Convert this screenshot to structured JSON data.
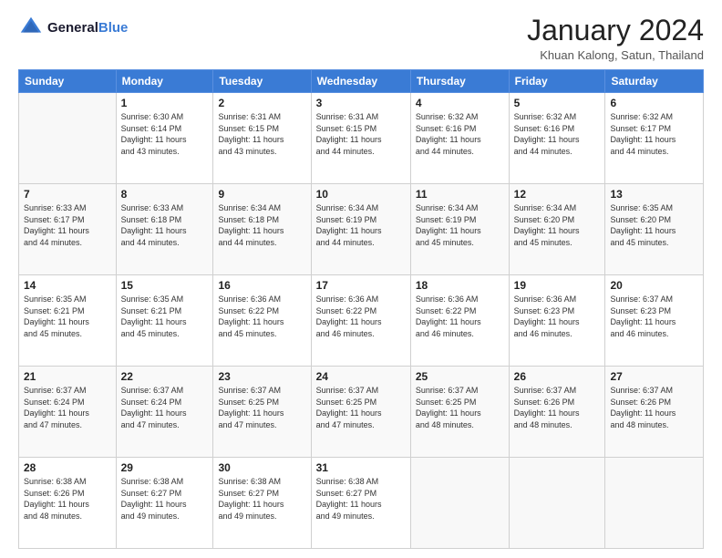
{
  "logo": {
    "line1": "General",
    "line2": "Blue"
  },
  "header": {
    "month_title": "January 2024",
    "location": "Khuan Kalong, Satun, Thailand"
  },
  "weekdays": [
    "Sunday",
    "Monday",
    "Tuesday",
    "Wednesday",
    "Thursday",
    "Friday",
    "Saturday"
  ],
  "weeks": [
    [
      {
        "day": "",
        "info": ""
      },
      {
        "day": "1",
        "info": "Sunrise: 6:30 AM\nSunset: 6:14 PM\nDaylight: 11 hours\nand 43 minutes."
      },
      {
        "day": "2",
        "info": "Sunrise: 6:31 AM\nSunset: 6:15 PM\nDaylight: 11 hours\nand 43 minutes."
      },
      {
        "day": "3",
        "info": "Sunrise: 6:31 AM\nSunset: 6:15 PM\nDaylight: 11 hours\nand 44 minutes."
      },
      {
        "day": "4",
        "info": "Sunrise: 6:32 AM\nSunset: 6:16 PM\nDaylight: 11 hours\nand 44 minutes."
      },
      {
        "day": "5",
        "info": "Sunrise: 6:32 AM\nSunset: 6:16 PM\nDaylight: 11 hours\nand 44 minutes."
      },
      {
        "day": "6",
        "info": "Sunrise: 6:32 AM\nSunset: 6:17 PM\nDaylight: 11 hours\nand 44 minutes."
      }
    ],
    [
      {
        "day": "7",
        "info": "Sunrise: 6:33 AM\nSunset: 6:17 PM\nDaylight: 11 hours\nand 44 minutes."
      },
      {
        "day": "8",
        "info": "Sunrise: 6:33 AM\nSunset: 6:18 PM\nDaylight: 11 hours\nand 44 minutes."
      },
      {
        "day": "9",
        "info": "Sunrise: 6:34 AM\nSunset: 6:18 PM\nDaylight: 11 hours\nand 44 minutes."
      },
      {
        "day": "10",
        "info": "Sunrise: 6:34 AM\nSunset: 6:19 PM\nDaylight: 11 hours\nand 44 minutes."
      },
      {
        "day": "11",
        "info": "Sunrise: 6:34 AM\nSunset: 6:19 PM\nDaylight: 11 hours\nand 45 minutes."
      },
      {
        "day": "12",
        "info": "Sunrise: 6:34 AM\nSunset: 6:20 PM\nDaylight: 11 hours\nand 45 minutes."
      },
      {
        "day": "13",
        "info": "Sunrise: 6:35 AM\nSunset: 6:20 PM\nDaylight: 11 hours\nand 45 minutes."
      }
    ],
    [
      {
        "day": "14",
        "info": "Sunrise: 6:35 AM\nSunset: 6:21 PM\nDaylight: 11 hours\nand 45 minutes."
      },
      {
        "day": "15",
        "info": "Sunrise: 6:35 AM\nSunset: 6:21 PM\nDaylight: 11 hours\nand 45 minutes."
      },
      {
        "day": "16",
        "info": "Sunrise: 6:36 AM\nSunset: 6:22 PM\nDaylight: 11 hours\nand 45 minutes."
      },
      {
        "day": "17",
        "info": "Sunrise: 6:36 AM\nSunset: 6:22 PM\nDaylight: 11 hours\nand 46 minutes."
      },
      {
        "day": "18",
        "info": "Sunrise: 6:36 AM\nSunset: 6:22 PM\nDaylight: 11 hours\nand 46 minutes."
      },
      {
        "day": "19",
        "info": "Sunrise: 6:36 AM\nSunset: 6:23 PM\nDaylight: 11 hours\nand 46 minutes."
      },
      {
        "day": "20",
        "info": "Sunrise: 6:37 AM\nSunset: 6:23 PM\nDaylight: 11 hours\nand 46 minutes."
      }
    ],
    [
      {
        "day": "21",
        "info": "Sunrise: 6:37 AM\nSunset: 6:24 PM\nDaylight: 11 hours\nand 47 minutes."
      },
      {
        "day": "22",
        "info": "Sunrise: 6:37 AM\nSunset: 6:24 PM\nDaylight: 11 hours\nand 47 minutes."
      },
      {
        "day": "23",
        "info": "Sunrise: 6:37 AM\nSunset: 6:25 PM\nDaylight: 11 hours\nand 47 minutes."
      },
      {
        "day": "24",
        "info": "Sunrise: 6:37 AM\nSunset: 6:25 PM\nDaylight: 11 hours\nand 47 minutes."
      },
      {
        "day": "25",
        "info": "Sunrise: 6:37 AM\nSunset: 6:25 PM\nDaylight: 11 hours\nand 48 minutes."
      },
      {
        "day": "26",
        "info": "Sunrise: 6:37 AM\nSunset: 6:26 PM\nDaylight: 11 hours\nand 48 minutes."
      },
      {
        "day": "27",
        "info": "Sunrise: 6:37 AM\nSunset: 6:26 PM\nDaylight: 11 hours\nand 48 minutes."
      }
    ],
    [
      {
        "day": "28",
        "info": "Sunrise: 6:38 AM\nSunset: 6:26 PM\nDaylight: 11 hours\nand 48 minutes."
      },
      {
        "day": "29",
        "info": "Sunrise: 6:38 AM\nSunset: 6:27 PM\nDaylight: 11 hours\nand 49 minutes."
      },
      {
        "day": "30",
        "info": "Sunrise: 6:38 AM\nSunset: 6:27 PM\nDaylight: 11 hours\nand 49 minutes."
      },
      {
        "day": "31",
        "info": "Sunrise: 6:38 AM\nSunset: 6:27 PM\nDaylight: 11 hours\nand 49 minutes."
      },
      {
        "day": "",
        "info": ""
      },
      {
        "day": "",
        "info": ""
      },
      {
        "day": "",
        "info": ""
      }
    ]
  ]
}
